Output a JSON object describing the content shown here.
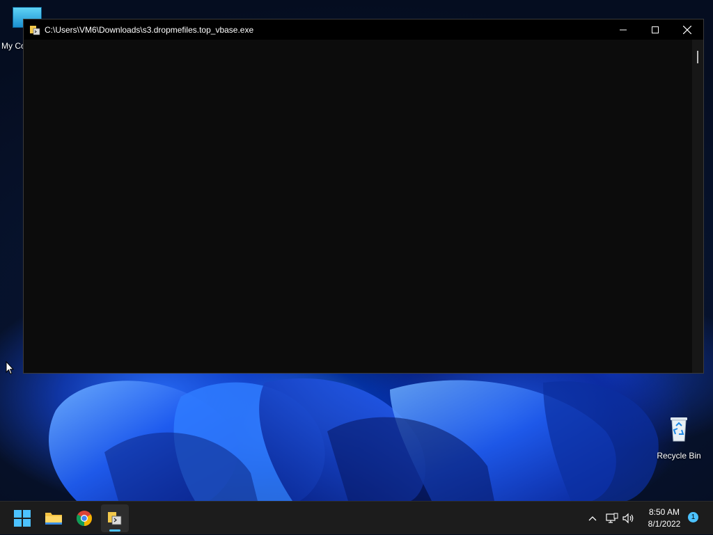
{
  "desktop": {
    "icons": [
      {
        "label": "My Co"
      },
      {
        "label": "Recycle Bin"
      }
    ]
  },
  "window": {
    "title": "C:\\Users\\VM6\\Downloads\\s3.dropmefiles.top_vbase.exe",
    "buttons": {
      "minimize": "minimize-icon",
      "maximize": "maximize-icon",
      "close": "close-icon"
    },
    "console_text": ""
  },
  "taskbar": {
    "apps": [
      {
        "name": "start-icon"
      },
      {
        "name": "file-explorer-icon"
      },
      {
        "name": "chrome-icon"
      },
      {
        "name": "console-app-icon",
        "active": true
      }
    ],
    "tray": {
      "icons": [
        "chevron-up-icon",
        "network-icon",
        "volume-icon"
      ],
      "time": "8:50 AM",
      "date": "8/1/2022",
      "notification_count": "1"
    }
  },
  "colors": {
    "accent": "#4cc2ff",
    "window_bg": "#0c0c0c",
    "taskbar_bg": "#1c1c1c"
  }
}
